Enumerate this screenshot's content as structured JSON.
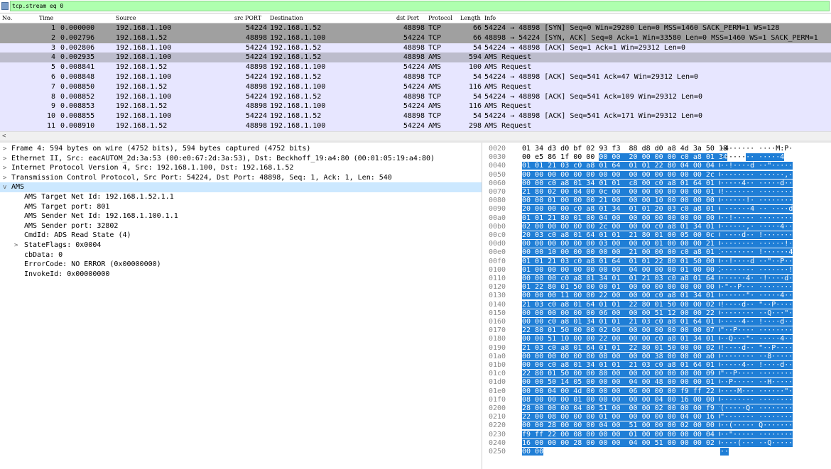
{
  "filter": {
    "value": "tcp.stream eq 0",
    "icon": "bookmark-icon"
  },
  "columns": [
    "No.",
    "Time",
    "Source",
    "src PORT",
    "Destination",
    "dst Port",
    "Protocol",
    "Length",
    "Info"
  ],
  "packets": [
    {
      "no": "1",
      "time": "0.000000",
      "src": "192.168.1.100",
      "sport": "54224",
      "dst": "192.168.1.52",
      "dport": "48898",
      "proto": "TCP",
      "len": "66",
      "info": "54224 → 48898 [SYN] Seq=0 Win=29200 Len=0 MSS=1460 SACK_PERM=1 WS=128",
      "bg": "#a0a0a0"
    },
    {
      "no": "2",
      "time": "0.002796",
      "src": "192.168.1.52",
      "sport": "48898",
      "dst": "192.168.1.100",
      "dport": "54224",
      "proto": "TCP",
      "len": "66",
      "info": "48898 → 54224 [SYN, ACK] Seq=0 Ack=1 Win=33580 Len=0 MSS=1460 WS=1 SACK_PERM=1",
      "bg": "#a0a0a0"
    },
    {
      "no": "3",
      "time": "0.002806",
      "src": "192.168.1.100",
      "sport": "54224",
      "dst": "192.168.1.52",
      "dport": "48898",
      "proto": "TCP",
      "len": "54",
      "info": "54224 → 48898 [ACK] Seq=1 Ack=1 Win=29312 Len=0",
      "bg": "#e7e6ff"
    },
    {
      "no": "4",
      "time": "0.002935",
      "src": "192.168.1.100",
      "sport": "54224",
      "dst": "192.168.1.52",
      "dport": "48898",
      "proto": "AMS",
      "len": "594",
      "info": "AMS Request",
      "bg": "#bcbccc"
    },
    {
      "no": "5",
      "time": "0.008841",
      "src": "192.168.1.52",
      "sport": "48898",
      "dst": "192.168.1.100",
      "dport": "54224",
      "proto": "AMS",
      "len": "100",
      "info": "AMS Request",
      "bg": "#e7e6ff"
    },
    {
      "no": "6",
      "time": "0.008848",
      "src": "192.168.1.100",
      "sport": "54224",
      "dst": "192.168.1.52",
      "dport": "48898",
      "proto": "TCP",
      "len": "54",
      "info": "54224 → 48898 [ACK] Seq=541 Ack=47 Win=29312 Len=0",
      "bg": "#e7e6ff"
    },
    {
      "no": "7",
      "time": "0.008850",
      "src": "192.168.1.52",
      "sport": "48898",
      "dst": "192.168.1.100",
      "dport": "54224",
      "proto": "AMS",
      "len": "116",
      "info": "AMS Request",
      "bg": "#e7e6ff"
    },
    {
      "no": "8",
      "time": "0.008852",
      "src": "192.168.1.100",
      "sport": "54224",
      "dst": "192.168.1.52",
      "dport": "48898",
      "proto": "TCP",
      "len": "54",
      "info": "54224 → 48898 [ACK] Seq=541 Ack=109 Win=29312 Len=0",
      "bg": "#e7e6ff"
    },
    {
      "no": "9",
      "time": "0.008853",
      "src": "192.168.1.52",
      "sport": "48898",
      "dst": "192.168.1.100",
      "dport": "54224",
      "proto": "AMS",
      "len": "116",
      "info": "AMS Request",
      "bg": "#e7e6ff"
    },
    {
      "no": "10",
      "time": "0.008855",
      "src": "192.168.1.100",
      "sport": "54224",
      "dst": "192.168.1.52",
      "dport": "48898",
      "proto": "TCP",
      "len": "54",
      "info": "54224 → 48898 [ACK] Seq=541 Ack=171 Win=29312 Len=0",
      "bg": "#e7e6ff"
    },
    {
      "no": "11",
      "time": "0.008910",
      "src": "192.168.1.52",
      "sport": "48898",
      "dst": "192.168.1.100",
      "dport": "54224",
      "proto": "AMS",
      "len": "298",
      "info": "AMS Request",
      "bg": "#e7e6ff"
    }
  ],
  "tree": [
    {
      "indent": 0,
      "exp": ">",
      "label": "Frame 4: 594 bytes on wire (4752 bits), 594 bytes captured (4752 bits)",
      "sel": false
    },
    {
      "indent": 0,
      "exp": ">",
      "label": "Ethernet II, Src: eacAUTOM_2d:3a:53 (00:e0:67:2d:3a:53), Dst: Beckhoff_19:a4:80 (00:01:05:19:a4:80)",
      "sel": false
    },
    {
      "indent": 0,
      "exp": ">",
      "label": "Internet Protocol Version 4, Src: 192.168.1.100, Dst: 192.168.1.52",
      "sel": false
    },
    {
      "indent": 0,
      "exp": ">",
      "label": "Transmission Control Protocol, Src Port: 54224, Dst Port: 48898, Seq: 1, Ack: 1, Len: 540",
      "sel": false
    },
    {
      "indent": 0,
      "exp": "v",
      "label": "AMS",
      "sel": true
    },
    {
      "indent": 1,
      "exp": "",
      "label": "AMS Target Net Id: 192.168.1.52.1.1",
      "sel": false
    },
    {
      "indent": 1,
      "exp": "",
      "label": "AMS Target port: 801",
      "sel": false
    },
    {
      "indent": 1,
      "exp": "",
      "label": "AMS Sender Net Id: 192.168.1.100.1.1",
      "sel": false
    },
    {
      "indent": 1,
      "exp": "",
      "label": "AMS Sender port: 32802",
      "sel": false
    },
    {
      "indent": 1,
      "exp": "",
      "label": "CmdId: ADS Read State (4)",
      "sel": false
    },
    {
      "indent": 1,
      "exp": ">",
      "label": "StateFlags: 0x0004",
      "sel": false
    },
    {
      "indent": 1,
      "exp": "",
      "label": "cbData: 0",
      "sel": false
    },
    {
      "indent": 1,
      "exp": "",
      "label": "ErrorCode: NO ERROR (0x00000000)",
      "sel": false
    },
    {
      "indent": 1,
      "exp": "",
      "label": "InvokeId: 0x00000000",
      "sel": false
    }
  ],
  "hex": [
    {
      "off": "0020",
      "pre": "01 34 d3 d0 bf 02 93 f3  88 d8 d0 a8 4d 3a 50 18",
      "hl": "",
      "apre": "·4······ ····M:P·",
      "ahl": ""
    },
    {
      "off": "0030",
      "pre": "00 e5 86 1f 00 00 ",
      "hl": "00 00  20 00 00 00 c0 a8 01 34",
      "apre": "······",
      "ahl": "·· ·····4"
    },
    {
      "off": "0040",
      "pre": "",
      "hl": "01 01 21 03 c0 a8 01 64  01 01 22 80 04 00 04 00",
      "apre": "",
      "ahl": "··!····d ··\"·····"
    },
    {
      "off": "0050",
      "pre": "",
      "hl": "00 00 00 00 00 00 00 00  00 00 00 00 00 00 2c 00",
      "apre": "",
      "ahl": "········ ······,·"
    },
    {
      "off": "0060",
      "pre": "",
      "hl": "00 00 c0 a8 01 34 01 01  c8 00 c0 a8 01 64 01 01",
      "apre": "",
      "ahl": "·····4·· ·····d··"
    },
    {
      "off": "0070",
      "pre": "",
      "hl": "21 80 02 00 04 00 0c 00  00 00 00 00 00 00 01 00",
      "apre": "",
      "ahl": "!······· ········"
    },
    {
      "off": "0080",
      "pre": "",
      "hl": "00 00 01 00 00 00 21 00  00 00 10 00 00 00 00 00",
      "apre": "",
      "ahl": "······!· ········"
    },
    {
      "off": "0090",
      "pre": "",
      "hl": "20 00 00 00 c0 a8 01 34  01 01 20 03 c0 a8 01 64",
      "apre": "",
      "ahl": " ······4 ·· ····d"
    },
    {
      "off": "00a0",
      "pre": "",
      "hl": "01 01 21 80 01 00 04 00  00 00 00 00 00 00 00 00",
      "apre": "",
      "ahl": "··!····· ········"
    },
    {
      "off": "00b0",
      "pre": "",
      "hl": "02 00 00 00 00 00 2c 00  00 00 c0 a8 01 34 01 01",
      "apre": "",
      "ahl": "······,· ·····4··"
    },
    {
      "off": "00c0",
      "pre": "",
      "hl": "20 03 c0 a8 01 64 01 01  21 80 01 00 05 00 0c 00",
      "apre": "",
      "ahl": " ····d·· !·······"
    },
    {
      "off": "00d0",
      "pre": "",
      "hl": "00 00 00 00 00 00 03 00  00 00 01 00 00 00 21 00",
      "apre": "",
      "ahl": "········ ······!·"
    },
    {
      "off": "00e0",
      "pre": "",
      "hl": "00 00 10 00 00 00 00 00  21 00 00 00 c0 a8 01 34",
      "apre": "",
      "ahl": "········ !······4"
    },
    {
      "off": "00f0",
      "pre": "",
      "hl": "01 01 21 03 c0 a8 01 64  01 01 22 80 01 50 00 00",
      "apre": "",
      "ahl": "··!····d ··\"··P··"
    },
    {
      "off": "0100",
      "pre": "",
      "hl": "01 00 00 00 00 00 00 00  04 00 00 00 01 00 00 21",
      "apre": "",
      "ahl": "········ ·······!"
    },
    {
      "off": "0110",
      "pre": "",
      "hl": "00 00 00 c0 a8 01 34 01  01 21 03 c0 a8 01 64 01",
      "apre": "",
      "ahl": "······4· ·!····d·"
    },
    {
      "off": "0120",
      "pre": "",
      "hl": "01 22 80 01 50 00 00 01  00 00 00 00 00 00 00 05",
      "apre": "",
      "ahl": "·\"··P··· ········"
    },
    {
      "off": "0130",
      "pre": "",
      "hl": "00 00 00 11 00 00 22 00  00 00 c0 a8 01 34 01 01",
      "apre": "",
      "ahl": "······\"· ·····4··"
    },
    {
      "off": "0140",
      "pre": "",
      "hl": "21 03 c0 a8 01 64 01 01  22 80 01 50 00 00 02 00",
      "apre": "",
      "ahl": "!····d·· \"··P····"
    },
    {
      "off": "0150",
      "pre": "",
      "hl": "00 00 00 00 00 00 06 00  00 00 51 12 00 00 22 00",
      "apre": "",
      "ahl": "········ ··Q···\"·"
    },
    {
      "off": "0160",
      "pre": "",
      "hl": "00 00 c0 a8 01 34 01 01  21 03 c0 a8 01 64 01 01",
      "apre": "",
      "ahl": "·····4·· !····d··"
    },
    {
      "off": "0170",
      "pre": "",
      "hl": "22 80 01 50 00 00 02 00  00 00 00 00 00 00 07 00",
      "apre": "",
      "ahl": "\"··P···· ········"
    },
    {
      "off": "0180",
      "pre": "",
      "hl": "00 00 51 10 00 00 22 00  00 00 c0 a8 01 34 01 01",
      "apre": "",
      "ahl": "··Q···\"· ·····4··"
    },
    {
      "off": "0190",
      "pre": "",
      "hl": "21 03 c0 a8 01 64 01 01  22 80 01 50 00 00 02 00",
      "apre": "",
      "ahl": "!····d·· \"··P····"
    },
    {
      "off": "01a0",
      "pre": "",
      "hl": "00 00 00 00 00 00 08 00  00 00 38 00 00 00 a0 00",
      "apre": "",
      "ahl": "········ ··8·····"
    },
    {
      "off": "01b0",
      "pre": "",
      "hl": "00 00 c0 a8 01 34 01 01  21 03 c0 a8 01 64 01 01",
      "apre": "",
      "ahl": "·····4·· !····d··"
    },
    {
      "off": "01c0",
      "pre": "",
      "hl": "22 80 01 50 00 00 80 00  00 00 00 00 00 00 09 00",
      "apre": "",
      "ahl": "\"··P···· ········"
    },
    {
      "off": "01d0",
      "pre": "",
      "hl": "00 00 50 14 05 00 00 00  04 00 48 00 00 00 01 00",
      "apre": "",
      "ahl": "··P····· ··H·····"
    },
    {
      "off": "01e0",
      "pre": "",
      "hl": "00 00 04 00 4d 00 00 00  06 00 00 00 f9 ff 22 00",
      "apre": "",
      "ahl": "····M··· ······\"·"
    },
    {
      "off": "01f0",
      "pre": "",
      "hl": "08 00 00 00 01 00 00 00  00 00 04 00 16 00 00 00",
      "apre": "",
      "ahl": "········ ········"
    },
    {
      "off": "0200",
      "pre": "",
      "hl": "28 00 00 00 04 00 51 00  00 00 02 00 00 00 f9 ff",
      "apre": "",
      "ahl": "(·····Q· ········"
    },
    {
      "off": "0210",
      "pre": "",
      "hl": "22 00 08 00 00 00 01 00  00 00 00 00 04 00 16 00",
      "apre": "",
      "ahl": "\"······· ········"
    },
    {
      "off": "0220",
      "pre": "",
      "hl": "00 00 28 00 00 00 04 00  51 00 00 00 02 00 00 00",
      "apre": "",
      "ahl": "··(····· Q·······"
    },
    {
      "off": "0230",
      "pre": "",
      "hl": "f9 ff 22 00 08 00 00 00  01 00 00 00 00 00 04 00",
      "apre": "",
      "ahl": "··\"····· ········"
    },
    {
      "off": "0240",
      "pre": "",
      "hl": "16 00 00 00 28 00 00 00  04 00 51 00 00 00 02 00",
      "apre": "",
      "ahl": "····(··· ··Q·····"
    },
    {
      "off": "0250",
      "pre": "",
      "hl": "00 00",
      "apre": "",
      "ahl": "··"
    }
  ]
}
